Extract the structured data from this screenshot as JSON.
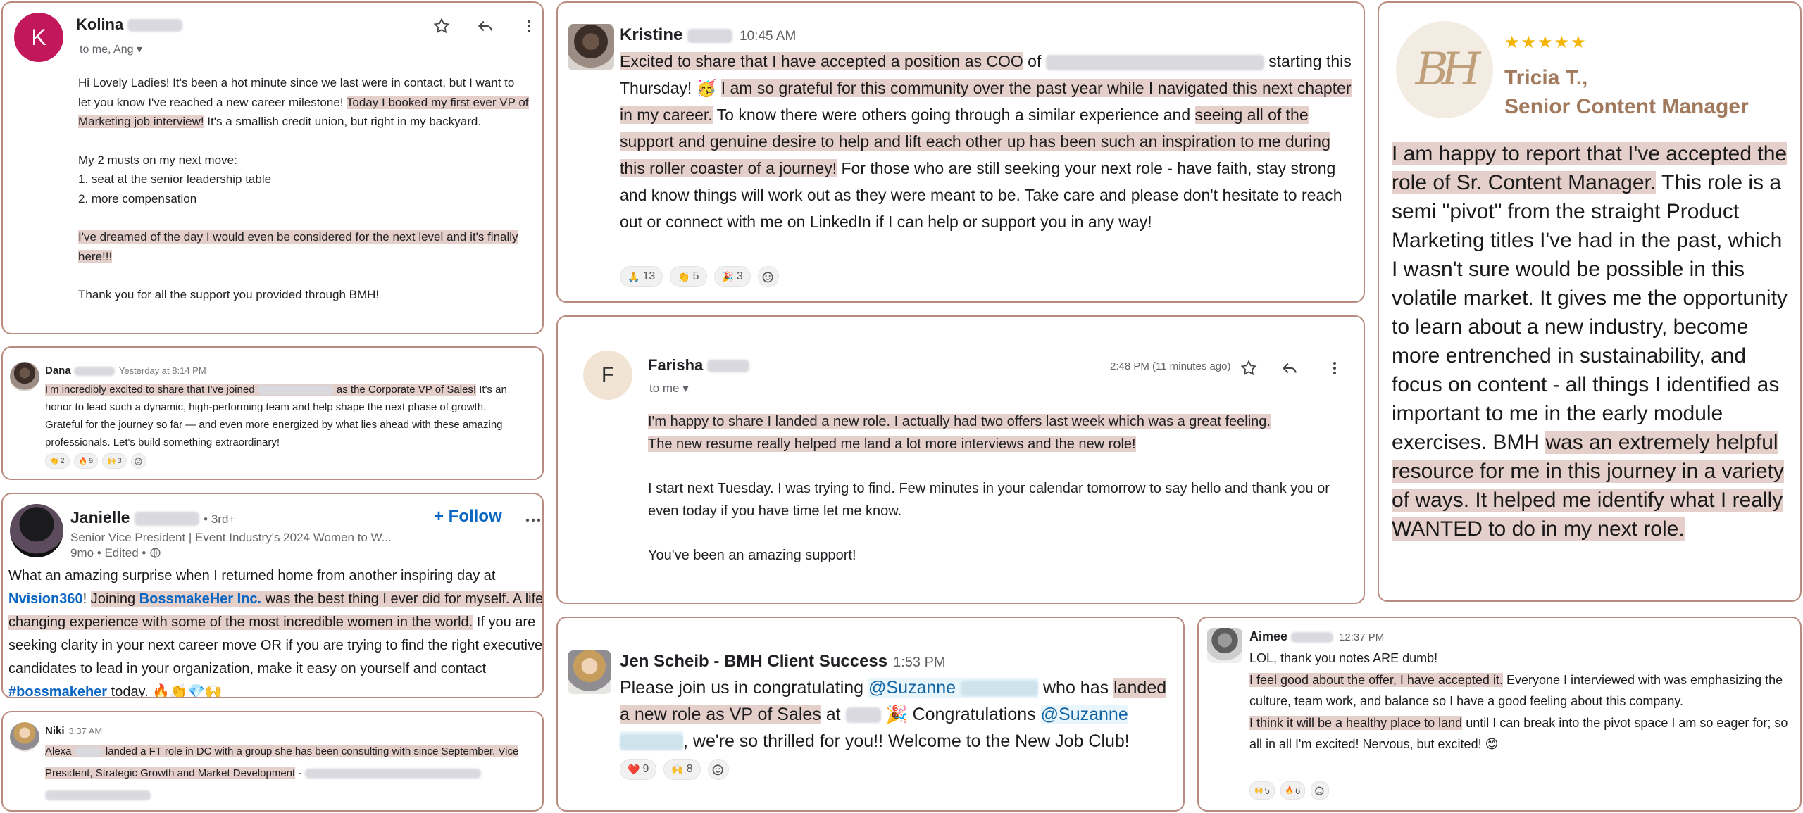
{
  "kolina": {
    "initial": "K",
    "name": "Kolina",
    "to": "to me, Ang",
    "p1a": "Hi Lovely Ladies! It's been a hot minute since we last were in contact, but I want to let you know I've reached a new career milestone! ",
    "p1hl": "Today I booked my first ever VP of Marketing job interview!",
    "p1b": " It's a smallish credit union, but right in my backyard.",
    "p2": "My 2 musts on my next move:",
    "p3": "1. seat at the senior leadership table",
    "p4": "2. more compensation",
    "p5hl": "I've dreamed of the day I would even be considered for the next level and it's finally here!!!",
    "p6": "Thank you for all the support you provided through BMH!"
  },
  "dana": {
    "name": "Dana",
    "time": "Yesterday at 8:14 PM",
    "hl1": "I'm incredibly excited to share that I've joined",
    "hl2": "as the Corporate VP of Sales!",
    "rest": " It's an honor to lead such a dynamic, high-performing team and help shape the next phase of growth. Grateful for the journey so far — and even more energized by what lies ahead with these amazing professionals. Let's build something extraordinary!",
    "reactions": [
      {
        "emoji": "👏",
        "count": "2"
      },
      {
        "emoji": "🔥",
        "count": "9"
      },
      {
        "emoji": "🙌",
        "count": "3"
      }
    ]
  },
  "janielle": {
    "name": "Janielle",
    "degree": "• 3rd+",
    "title": "Senior Vice President | Event Industry's 2024 Women to W...",
    "meta": "9mo • Edited •",
    "follow": "+ Follow",
    "t1": "What an amazing surprise when I returned home from another inspiring day at ",
    "link1": "Nvision360",
    "t2": "! ",
    "hl1": "Joining ",
    "link2": "BossmakeHer Inc.",
    "hl2": " was the best thing I ever did for myself. A life changing experience with some of the most incredible women in the world.",
    "t3": " If you are seeking clarity in your next career move OR if you are trying to find the right executive candidates to lead in your organization, make it easy on yourself and contact ",
    "tag": "#bossmakeher",
    "t4": " today. 🔥👏💎🙌"
  },
  "niki": {
    "name": "Niki",
    "time": "3:37 AM",
    "hl1": "Alexa",
    "hl2": "landed a FT role in DC with a group she has been consulting with since September. Vice President, Strategic Growth and Market Development",
    "dash": " - "
  },
  "kristine": {
    "name": "Kristine",
    "time": "10:45 AM",
    "hl1": "Excited to share that I have accepted a position as COO",
    "t1": " of ",
    "t2": " starting this Thursday! 🥳 ",
    "hl2": "I am so grateful for this community over the past year while I navigated this next chapter in my career.",
    "t3": " To know there were others going through a similar experience and ",
    "hl3": "seeing all of the support and genuine desire to help and lift each other up has been such an inspiration to me during this roller coaster of a journey!",
    "t4": " For those who are still seeking your next role - have faith, stay strong and know things will work out as they were meant to be. Take care and please don't hesitate to reach out or connect with me on LinkedIn if I can help or support you in any way!",
    "reactions": [
      {
        "emoji": "🙏",
        "count": "13"
      },
      {
        "emoji": "👏",
        "count": "5"
      },
      {
        "emoji": "🎉",
        "count": "3"
      }
    ]
  },
  "farisha": {
    "initial": "F",
    "name": "Farisha",
    "to": "to me",
    "time": "2:48 PM (11 minutes ago)",
    "hl1": "I'm happy to share I landed a new role. I actually had two offers last week which was a great feeling.",
    "hl2": "The new resume really helped me land a lot more interviews and the new role!",
    "p2": "I start next Tuesday. I was trying to find. Few minutes in your calendar tomorrow to say hello and thank you or even today if you have time let me know.",
    "p3": "You've been an amazing support!"
  },
  "tricia": {
    "logo": "BH",
    "stars": "★★★★★",
    "name1": "Tricia T.,",
    "name2": "Senior Content Manager",
    "hl1": "I am happy to report that I've accepted the role of Sr. Content Manager.",
    "t1": " This role is a semi \"pivot\" from the straight Product Marketing titles I've had in the past, which I wasn't sure would be possible in this volatile market. It gives me the opportunity to learn about a new industry, become more entrenched in sustainability, and focus on content - all things I identified as important to me in the early module exercises. BMH ",
    "hl2": "was an extremely helpful resource for me in this journey in a variety of ways. It helped me identify what I really WANTED to do in my next role."
  },
  "jen": {
    "name": "Jen Scheib - BMH Client Success",
    "time": "1:53 PM",
    "t1": "Please join us in congratulating ",
    "mention1": "@Suzanne",
    "t2": " who has ",
    "hl1": "landed a new role as VP of Sales",
    "t3": " at ",
    "t4": " 🎉 Congratulations ",
    "mention2": "@Suzanne",
    "t5": ", we're so thrilled for you!! Welcome to the New Job Club!",
    "reactions": [
      {
        "emoji": "❤️",
        "count": "9"
      },
      {
        "emoji": "🙌",
        "count": "8"
      }
    ]
  },
  "aimee": {
    "name": "Aimee",
    "time": "12:37 PM",
    "l1": "LOL, thank you notes ARE dumb!",
    "hl1": "I feel good about the offer, I have accepted it.",
    "t1": " Everyone I interviewed with was emphasizing the culture, team work, and balance so I have a good feeling about this company.",
    "hl2": "I think it will be a healthy place to land",
    "t2": " until I can break into the pivot space I am so eager for; so all in all I'm excited! Nervous, but excited! 😊",
    "reactions": [
      {
        "emoji": "🙌",
        "count": "5"
      },
      {
        "emoji": "🔥",
        "count": "6"
      }
    ]
  },
  "colors": {
    "border": "#b98a80",
    "highlight": "#e4cfca",
    "linkedin_blue": "#0a66c2",
    "slack_mention": "#1264a3",
    "gmail_avatar": "#c2185b",
    "tricia_title": "#a17a5e"
  }
}
